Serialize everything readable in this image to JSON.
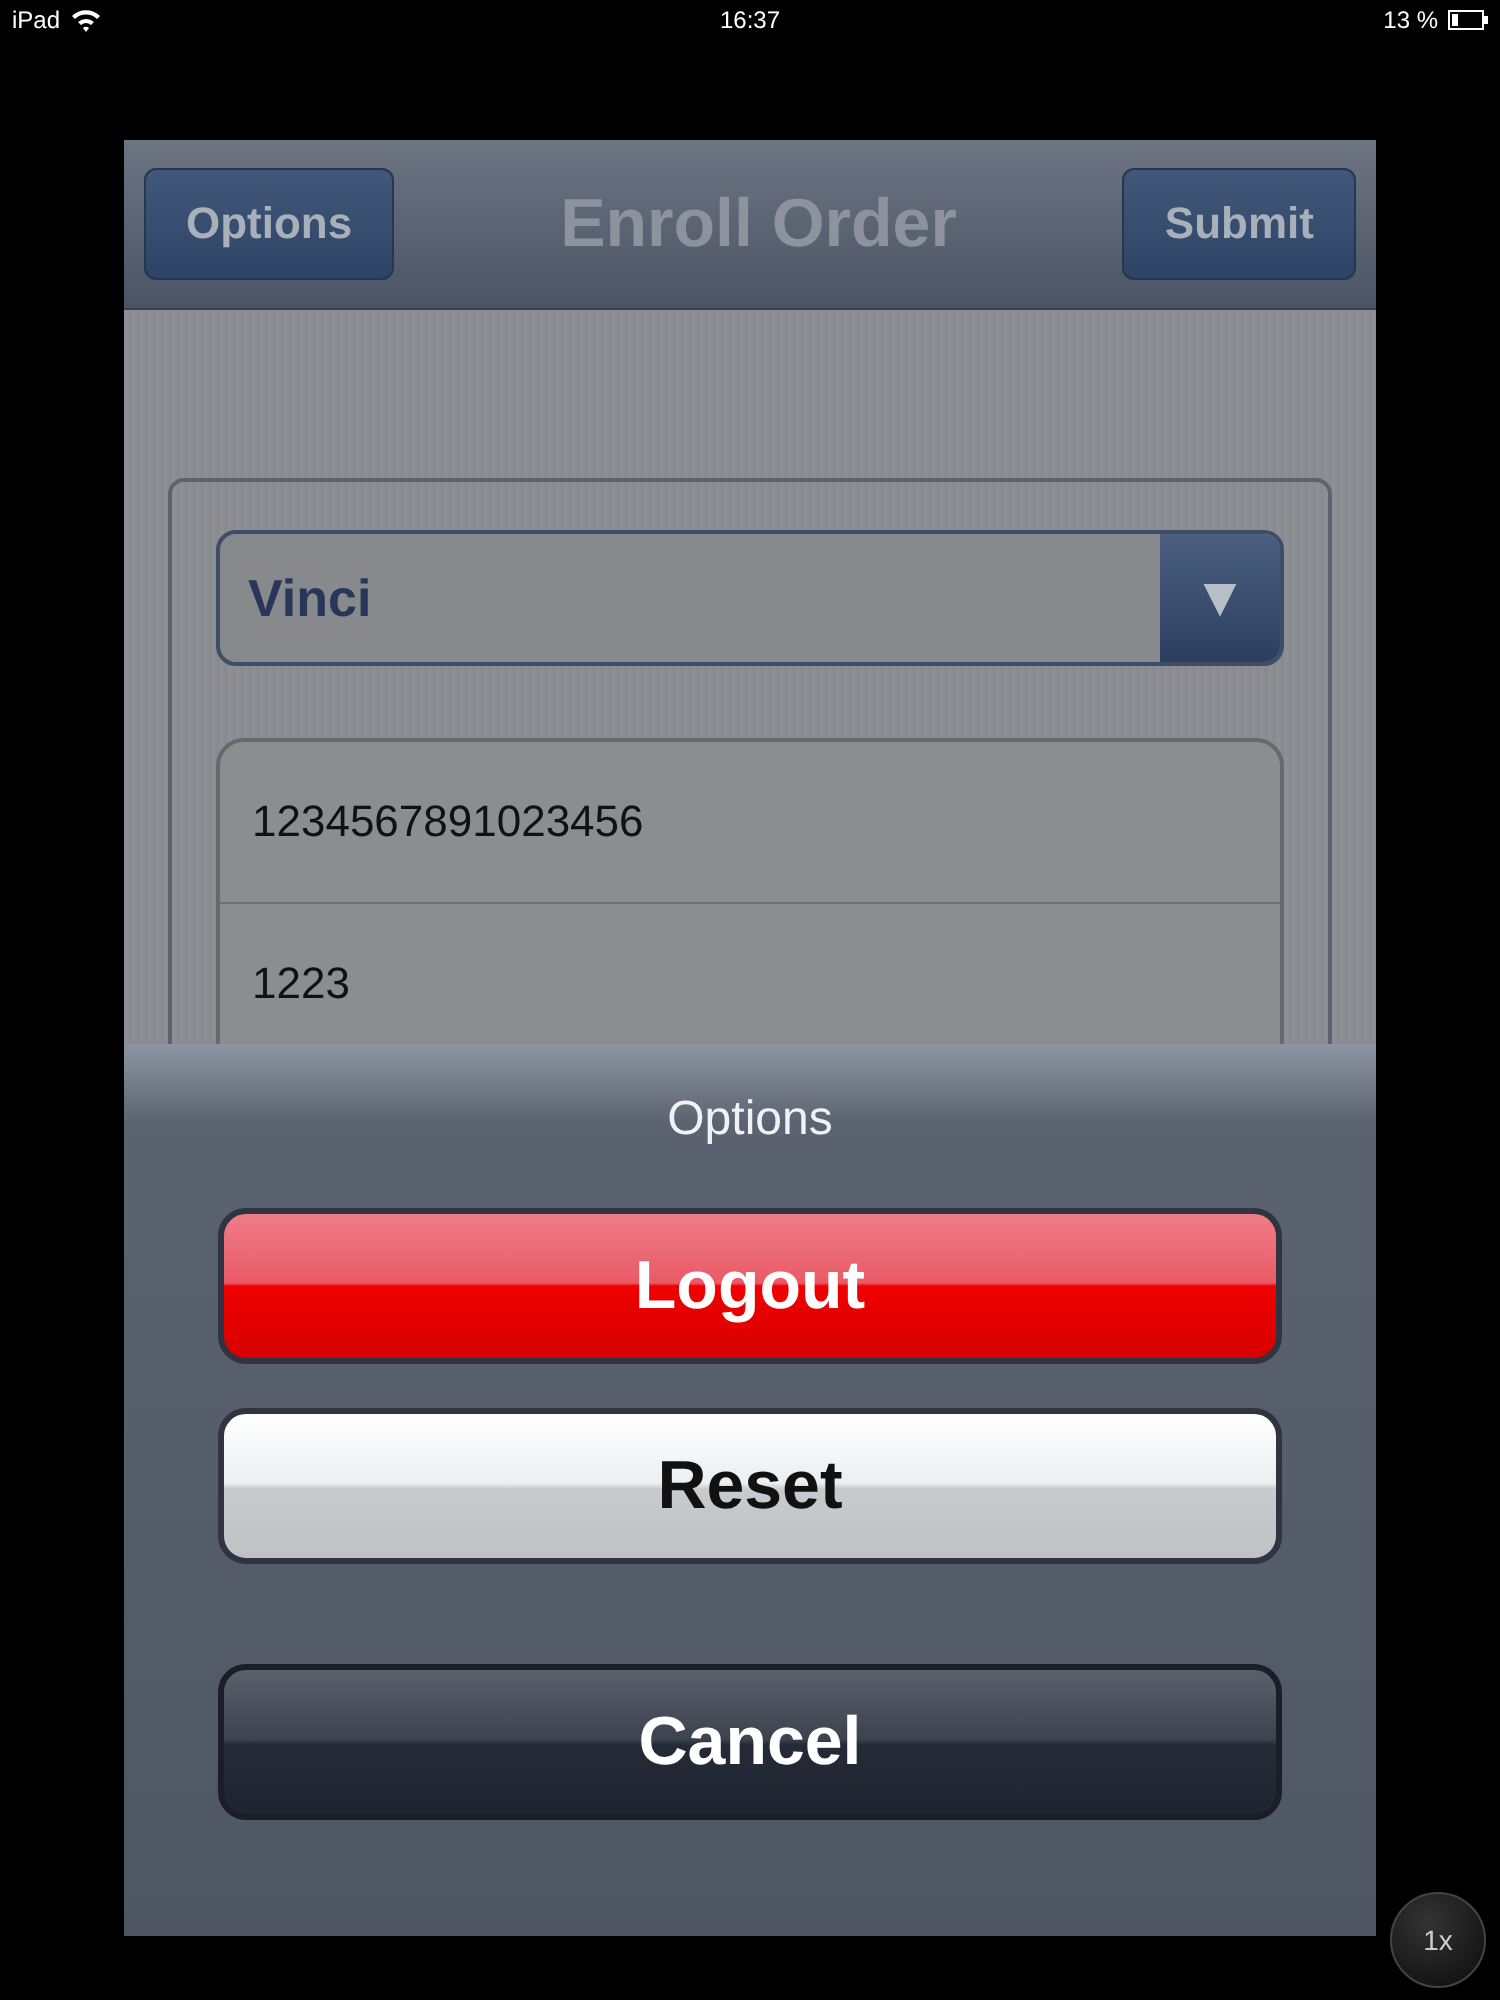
{
  "status_bar": {
    "carrier": "iPad",
    "time": "16:37",
    "battery": "13 %"
  },
  "nav_bar": {
    "left_button": "Options",
    "title": "Enroll Order",
    "right_button": "Submit"
  },
  "form": {
    "dropdown": {
      "value": "Vinci",
      "arrow": "▼"
    },
    "fields": [
      {
        "value": "1234567891023456"
      },
      {
        "value": "1223"
      }
    ]
  },
  "action_sheet": {
    "title": "Options",
    "buttons": [
      {
        "label": "Logout",
        "kind": "destructive"
      },
      {
        "label": "Reset",
        "kind": "default"
      },
      {
        "label": "Cancel",
        "kind": "cancel"
      }
    ]
  },
  "zoom_badge": "1x"
}
